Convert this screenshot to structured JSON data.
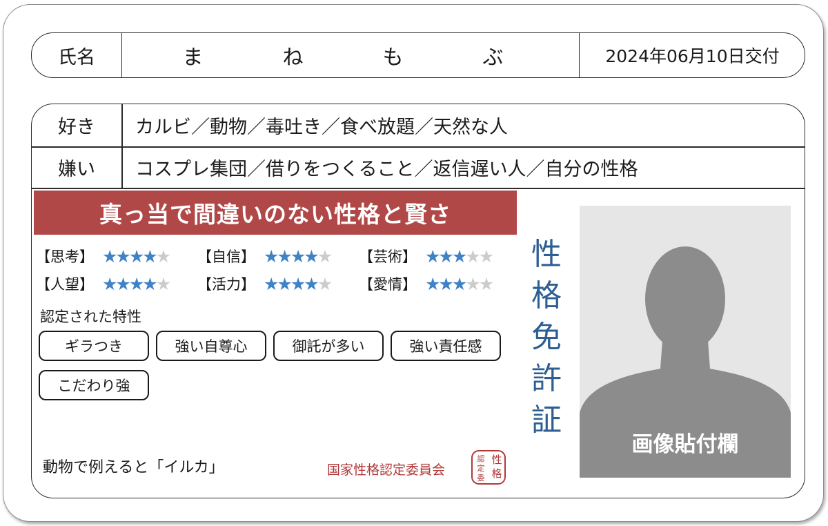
{
  "name": {
    "label": "氏名",
    "chars": [
      "ま",
      "ね",
      "も",
      "ぶ"
    ],
    "issue_date": "2024年06月10日交付"
  },
  "likes": {
    "label": "好き",
    "value": "カルビ／動物／毒吐き／食べ放題／天然な人"
  },
  "dislikes": {
    "label": "嫌い",
    "value": "コスプレ集団／借りをつくること／返信遅い人／自分の性格"
  },
  "banner": "真っ当で間違いのない性格と賢さ",
  "stats": [
    [
      {
        "label": "【思考】",
        "rating": 4,
        "max": 5
      },
      {
        "label": "【自信】",
        "rating": 4,
        "max": 5
      },
      {
        "label": "【芸術】",
        "rating": 3,
        "max": 5
      }
    ],
    [
      {
        "label": "【人望】",
        "rating": 4,
        "max": 5
      },
      {
        "label": "【活力】",
        "rating": 4,
        "max": 5
      },
      {
        "label": "【愛情】",
        "rating": 3,
        "max": 5
      }
    ]
  ],
  "traits": {
    "title": "認定された特性",
    "items": [
      "ギラつき",
      "強い自尊心",
      "御託が多い",
      "強い責任感",
      "こだわり強"
    ]
  },
  "animal": "動物で例えると「イルカ」",
  "committee": "国家性格認定委員会",
  "seal": [
    "性",
    "格",
    "認",
    "定",
    "委"
  ],
  "vertical_title": [
    "性",
    "格",
    "免",
    "許",
    "証"
  ],
  "photo_label": "画像貼付欄",
  "colors": {
    "banner": "#b14848",
    "star_on": "#3f82c5",
    "star_off": "#cccccc",
    "title_blue": "#2d5f93",
    "committee_red": "#b13838",
    "silhouette": "#8c8c8c"
  }
}
